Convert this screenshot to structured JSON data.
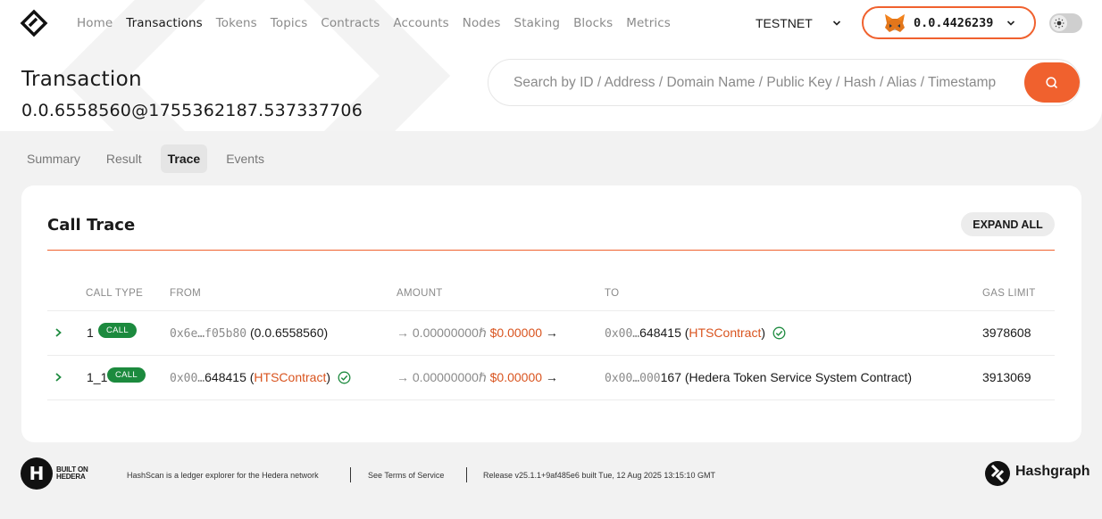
{
  "nav": {
    "items": [
      {
        "label": "Home"
      },
      {
        "label": "Transactions"
      },
      {
        "label": "Tokens"
      },
      {
        "label": "Topics"
      },
      {
        "label": "Contracts"
      },
      {
        "label": "Accounts"
      },
      {
        "label": "Nodes"
      },
      {
        "label": "Staking"
      },
      {
        "label": "Blocks"
      },
      {
        "label": "Metrics"
      }
    ],
    "active": "Transactions",
    "network": "TESTNET",
    "wallet_account": "0.0.4426239"
  },
  "header": {
    "title": "Transaction",
    "transaction_id": "0.0.6558560@1755362187.537337706"
  },
  "search": {
    "placeholder": "Search by ID / Address / Domain Name / Public Key / Hash / Alias / Timestamp"
  },
  "tabs": [
    {
      "label": "Summary"
    },
    {
      "label": "Result"
    },
    {
      "label": "Trace"
    },
    {
      "label": "Events"
    }
  ],
  "active_tab": "Trace",
  "call_trace": {
    "title": "Call Trace",
    "expand_all_label": "EXPAND ALL",
    "columns": [
      "CALL TYPE",
      "FROM",
      "AMOUNT",
      "TO",
      "GAS LIMIT"
    ],
    "rows": [
      {
        "depth": "1",
        "call_type": "CALL",
        "from_address": "0x6e…f05b80",
        "from_name": "(0.0.6558560)",
        "amount_hbar": "→ 0.00000000ℏ",
        "amount_usd": "$0.00000",
        "amount_arrow": "→",
        "to_prefix": "0x00…",
        "to_suffix": "648415",
        "to_name": "HTSContract",
        "to_verified": true,
        "gas_limit": "3978608"
      },
      {
        "depth": "1_1",
        "call_type": "CALL",
        "from_prefix": "0x00…",
        "from_suffix": "648415",
        "from_name": "HTSContract",
        "from_verified": true,
        "amount_hbar": "→ 0.00000000ℏ",
        "amount_usd": "$0.00000",
        "amount_arrow": "→",
        "to_prefix": "0x00…000",
        "to_suffix": "167",
        "to_name": "(Hedera Token Service System Contract)",
        "gas_limit": "3913069"
      }
    ]
  },
  "footer": {
    "built_on_line1": "BUILT ON",
    "built_on_line2": "HEDERA",
    "tagline": "HashScan is a ledger explorer for the Hedera network",
    "terms": "See Terms of Service",
    "release": "Release v25.1.1+9af485e6 built Tue, 12 Aug 2025 13:15:10 GMT",
    "brand": "Hashgraph"
  },
  "colors": {
    "accent": "#f0612e",
    "link": "#d9541f",
    "call_badge": "#1c8a3e"
  }
}
